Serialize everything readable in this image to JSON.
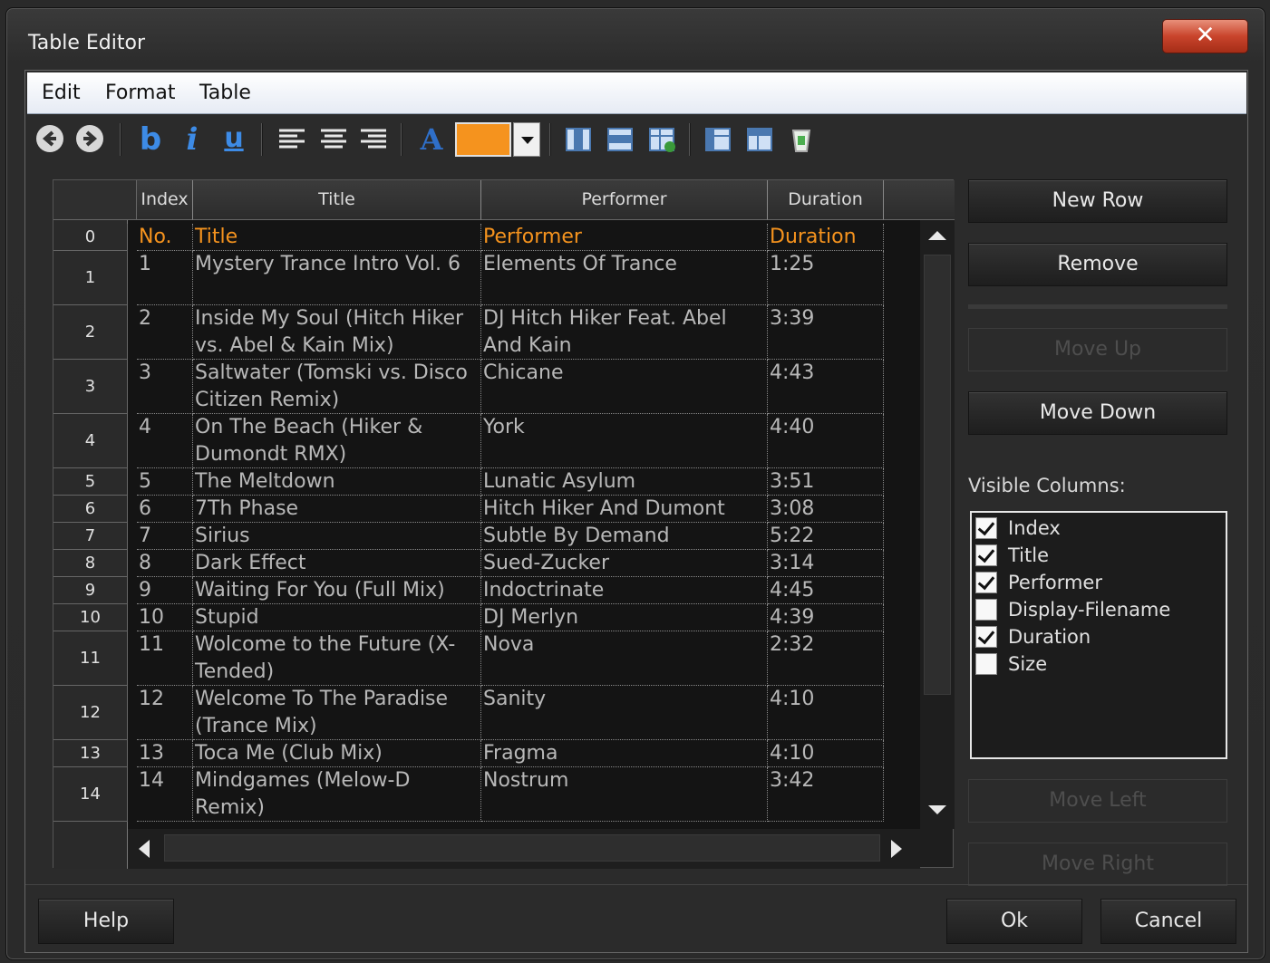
{
  "window": {
    "title": "Table Editor",
    "close_glyph": "✕"
  },
  "menu": {
    "items": [
      "Edit",
      "Format",
      "Table"
    ]
  },
  "toolbar": {
    "bold": "b",
    "italic": "i",
    "underline": "u",
    "font_color_glyph": "A",
    "highlight_color": "#f5931e"
  },
  "grid": {
    "columns": [
      "Index",
      "Title",
      "Performer",
      "Duration"
    ],
    "row_indices": [
      "0",
      "1",
      "2",
      "3",
      "4",
      "5",
      "6",
      "7",
      "8",
      "9",
      "10",
      "11",
      "12",
      "13",
      "14"
    ],
    "header_row": [
      "No.",
      "Title",
      "Performer",
      "Duration"
    ],
    "rows": [
      {
        "no": "1",
        "title": "Mystery Trance Intro Vol. 6",
        "performer": "Elements Of Trance",
        "duration": "1:25"
      },
      {
        "no": "2",
        "title": "Inside My Soul (Hitch Hiker vs. Abel & Kain Mix)",
        "performer": "DJ Hitch Hiker Feat. Abel And Kain",
        "duration": "3:39"
      },
      {
        "no": "3",
        "title": "Saltwater (Tomski vs. Disco Citizen Remix)",
        "performer": "Chicane",
        "duration": "4:43"
      },
      {
        "no": "4",
        "title": "On The Beach (Hiker & Dumondt RMX)",
        "performer": "York",
        "duration": "4:40"
      },
      {
        "no": "5",
        "title": "The Meltdown",
        "performer": "Lunatic Asylum",
        "duration": "3:51"
      },
      {
        "no": "6",
        "title": "7Th Phase",
        "performer": "Hitch Hiker And Dumont",
        "duration": "3:08"
      },
      {
        "no": "7",
        "title": "Sirius",
        "performer": "Subtle By Demand",
        "duration": "5:22"
      },
      {
        "no": "8",
        "title": "Dark Effect",
        "performer": "Sued-Zucker",
        "duration": "3:14"
      },
      {
        "no": "9",
        "title": "Waiting For You (Full Mix)",
        "performer": "Indoctrinate",
        "duration": "4:45"
      },
      {
        "no": "10",
        "title": "Stupid",
        "performer": "DJ Merlyn",
        "duration": "4:39"
      },
      {
        "no": "11",
        "title": "Wolcome to the Future (X-Tended)",
        "performer": "Nova",
        "duration": "2:32"
      },
      {
        "no": "12",
        "title": "Welcome To The Paradise (Trance Mix)",
        "performer": "Sanity",
        "duration": "4:10"
      },
      {
        "no": "13",
        "title": "Toca Me (Club Mix)",
        "performer": "Fragma",
        "duration": "4:10"
      },
      {
        "no": "14",
        "title": "Mindgames (Melow-D Remix)",
        "performer": "Nostrum",
        "duration": "3:42"
      }
    ]
  },
  "side": {
    "new_row": "New Row",
    "remove": "Remove",
    "move_up": "Move Up",
    "move_down": "Move Down",
    "visible_columns_label": "Visible Columns:",
    "visible_columns": [
      {
        "label": "Index",
        "checked": true
      },
      {
        "label": "Title",
        "checked": true
      },
      {
        "label": "Performer",
        "checked": true
      },
      {
        "label": "Display-Filename",
        "checked": false
      },
      {
        "label": "Duration",
        "checked": true
      },
      {
        "label": "Size",
        "checked": false
      }
    ],
    "move_left": "Move Left",
    "move_right": "Move Right"
  },
  "footer": {
    "help": "Help",
    "ok": "Ok",
    "cancel": "Cancel"
  }
}
